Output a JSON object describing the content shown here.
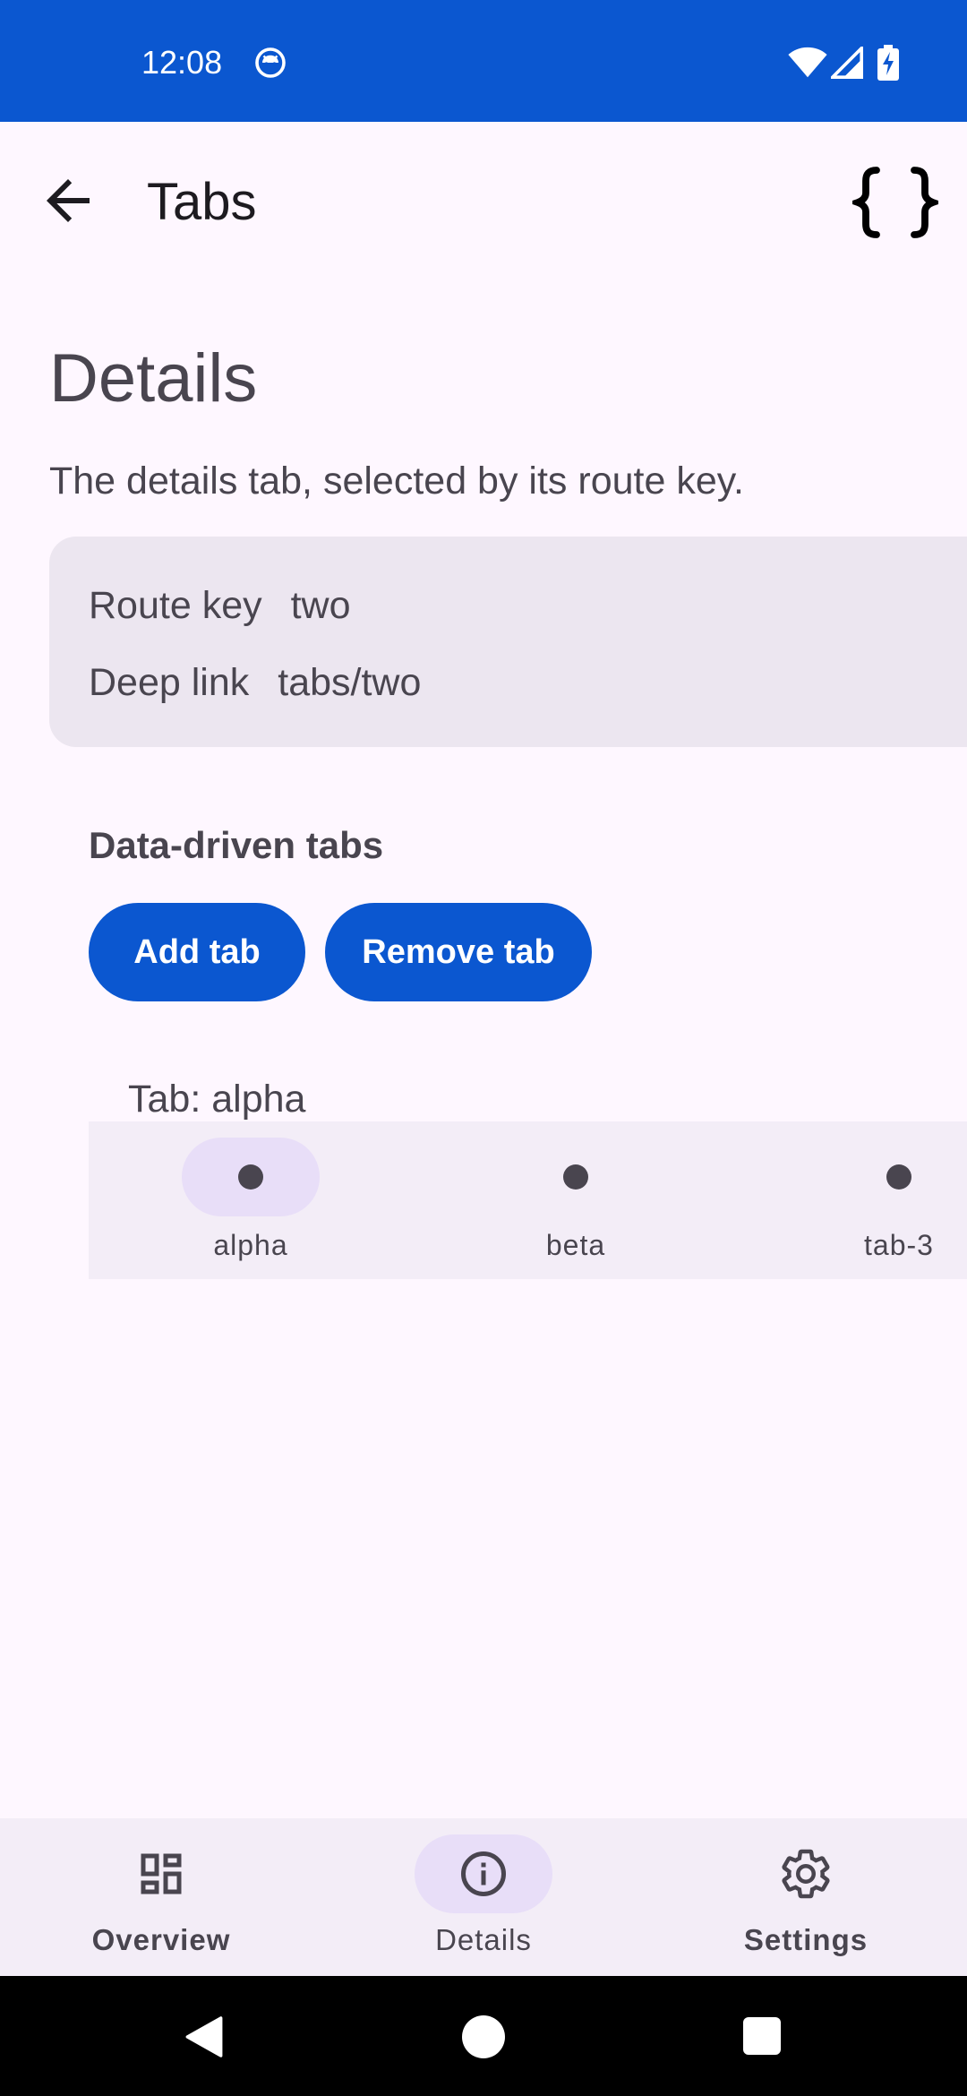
{
  "status_bar": {
    "time": "12:08",
    "icons": [
      "face-notification-icon",
      "wifi-icon",
      "signal-icon",
      "battery-charging-icon"
    ],
    "background": "#0B57D0"
  },
  "top_bar": {
    "title": "Tabs",
    "back_icon": "arrow-back-icon",
    "action_icon": "curly-braces-icon"
  },
  "content": {
    "heading": "Details",
    "description": "The details tab, selected by its route key.",
    "info_card": {
      "route_key_label": "Route key",
      "route_key_value": "two",
      "deep_link_label": "Deep link",
      "deep_link_value": "tabs/two"
    },
    "section_title": "Data-driven tabs",
    "add_tab_button": "Add tab",
    "remove_tab_button": "Remove tab",
    "current_tab_label": "Tab: alpha",
    "tabs": [
      {
        "label": "alpha",
        "selected": true
      },
      {
        "label": "beta",
        "selected": false
      },
      {
        "label": "tab-3",
        "selected": false
      }
    ]
  },
  "bottom_nav": {
    "items": [
      {
        "label": "Overview",
        "icon": "dashboard-icon",
        "selected": false
      },
      {
        "label": "Details",
        "icon": "info-icon",
        "selected": true
      },
      {
        "label": "Settings",
        "icon": "gear-icon",
        "selected": false
      }
    ]
  },
  "colors": {
    "primary": "#0B57D0",
    "surface": "#FEF7FF",
    "surface_container": "#F3EDF7",
    "indicator": "#E8DEF8",
    "card": "#ECE6F0",
    "on_surface_variant": "#49454F"
  }
}
